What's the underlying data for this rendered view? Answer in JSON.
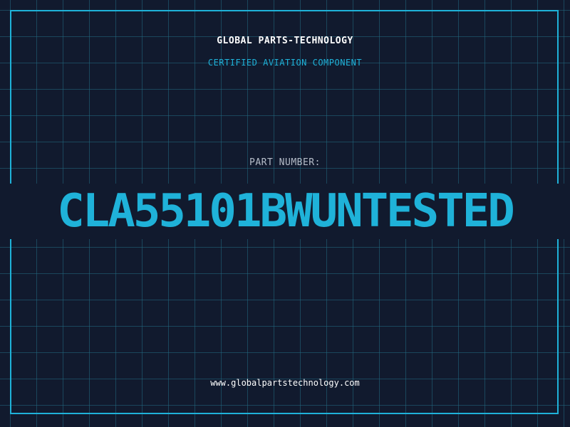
{
  "header": {
    "company": "GLOBAL PARTS-TECHNOLOGY",
    "subtitle": "CERTIFIED AVIATION COMPONENT"
  },
  "part": {
    "label": "PART NUMBER:",
    "number": "CLA55101BWUNTESTED"
  },
  "footer": {
    "url": "www.globalpartstechnology.com"
  },
  "colors": {
    "background": "#111a2e",
    "accent": "#1fb2d9",
    "grid": "#226982",
    "text_primary": "#ffffff",
    "text_muted": "#b5bcc8"
  }
}
